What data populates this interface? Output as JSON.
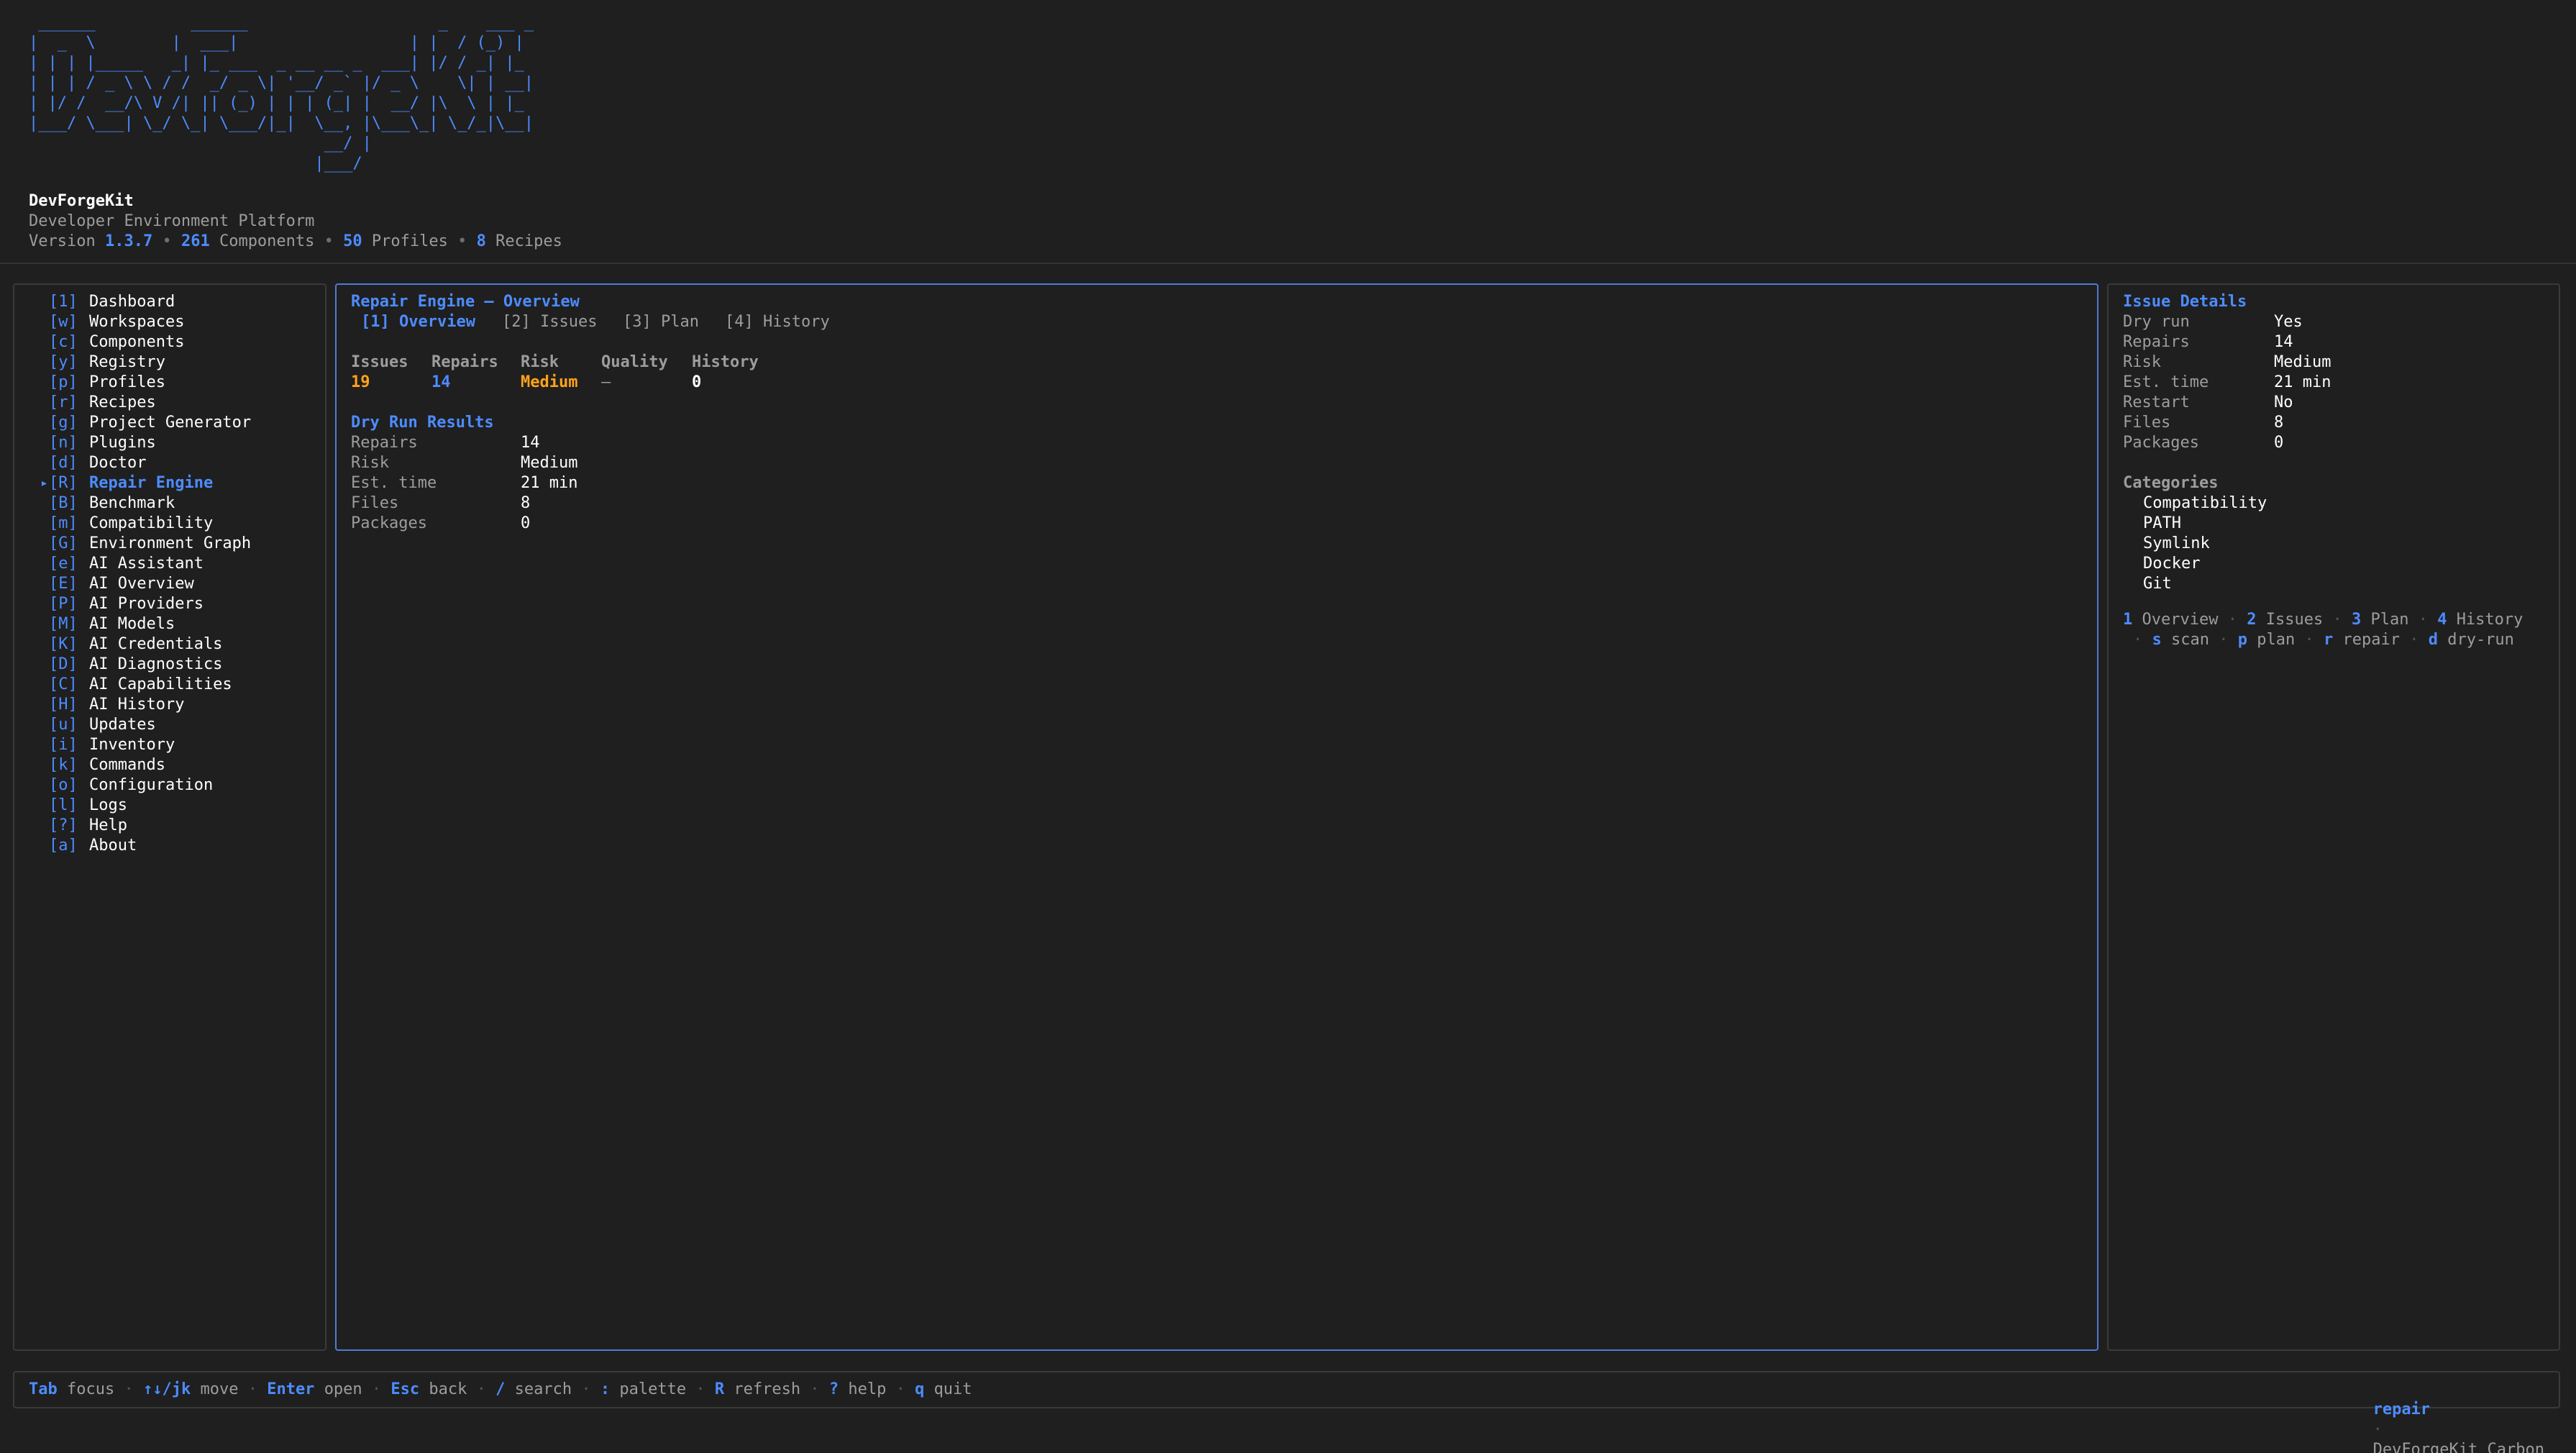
{
  "header": {
    "ascii_logo": " ______          ______                    _    ___ _\n|  _  \\        |  ___|                  | |  / (_) |\n| | | |_____   _| |_ ___  _ __ __ _  ___| |/ / _| |_\n| | | / _ \\ \\ / /  _/ _ \\| '__/ _` |/ _ \\    \\| | __|\n| |/ /  __/\\ V /| || (_) | | | (_| |  __/ |\\  \\ | |_\n|___/ \\___| \\_/ \\_| \\___/|_|  \\__, |\\___\\_| \\_/_|\\__|\n                               __/ |\n                              |___/",
    "brand_name": "DevForgeKit",
    "brand_sub": "Developer Environment Platform",
    "stats": {
      "version_label": "Version",
      "version": "1.3.7",
      "components_count": "261",
      "components_label": "Components",
      "profiles_count": "50",
      "profiles_label": "Profiles",
      "recipes_count": "8",
      "recipes_label": "Recipes",
      "sep": "•"
    }
  },
  "sidebar": {
    "items": [
      {
        "key": "[1]",
        "label": "Dashboard"
      },
      {
        "key": "[w]",
        "label": "Workspaces"
      },
      {
        "key": "[c]",
        "label": "Components"
      },
      {
        "key": "[y]",
        "label": "Registry"
      },
      {
        "key": "[p]",
        "label": "Profiles"
      },
      {
        "key": "[r]",
        "label": "Recipes"
      },
      {
        "key": "[g]",
        "label": "Project Generator"
      },
      {
        "key": "[n]",
        "label": "Plugins"
      },
      {
        "key": "[d]",
        "label": "Doctor"
      },
      {
        "key": "[R]",
        "label": "Repair Engine",
        "active": true
      },
      {
        "key": "[B]",
        "label": "Benchmark"
      },
      {
        "key": "[m]",
        "label": "Compatibility"
      },
      {
        "key": "[G]",
        "label": "Environment Graph"
      },
      {
        "key": "[e]",
        "label": "AI Assistant"
      },
      {
        "key": "[E]",
        "label": "AI Overview"
      },
      {
        "key": "[P]",
        "label": "AI Providers"
      },
      {
        "key": "[M]",
        "label": "AI Models"
      },
      {
        "key": "[K]",
        "label": "AI Credentials"
      },
      {
        "key": "[D]",
        "label": "AI Diagnostics"
      },
      {
        "key": "[C]",
        "label": "AI Capabilities"
      },
      {
        "key": "[H]",
        "label": "AI History"
      },
      {
        "key": "[u]",
        "label": "Updates"
      },
      {
        "key": "[i]",
        "label": "Inventory"
      },
      {
        "key": "[k]",
        "label": "Commands"
      },
      {
        "key": "[o]",
        "label": "Configuration"
      },
      {
        "key": "[l]",
        "label": "Logs"
      },
      {
        "key": "[?]",
        "label": "Help"
      },
      {
        "key": "[a]",
        "label": "About"
      }
    ],
    "active_marker": "▸"
  },
  "main": {
    "title": "Repair Engine — Overview",
    "tabs": [
      {
        "label": "[1] Overview",
        "active": true
      },
      {
        "label": "[2] Issues"
      },
      {
        "label": "[3] Plan"
      },
      {
        "label": "[4] History"
      }
    ],
    "summary": {
      "headers": [
        "Issues",
        "Repairs",
        "Risk",
        "Quality",
        "History"
      ],
      "values": [
        "19",
        "14",
        "Medium",
        "—",
        "0"
      ]
    },
    "dry_run": {
      "title": "Dry Run Results",
      "rows": [
        {
          "label": "Repairs",
          "value": "14"
        },
        {
          "label": "Risk",
          "value": "Medium"
        },
        {
          "label": "Est. time",
          "value": "21 min"
        },
        {
          "label": "Files",
          "value": "8"
        },
        {
          "label": "Packages",
          "value": "0"
        }
      ]
    }
  },
  "details": {
    "title": "Issue Details",
    "rows": [
      {
        "label": "Dry run",
        "value": "Yes"
      },
      {
        "label": "Repairs",
        "value": "14"
      },
      {
        "label": "Risk",
        "value": "Medium"
      },
      {
        "label": "Est. time",
        "value": "21 min"
      },
      {
        "label": "Restart",
        "value": "No"
      },
      {
        "label": "Files",
        "value": "8"
      },
      {
        "label": "Packages",
        "value": "0"
      }
    ],
    "categories_title": "Categories",
    "categories": [
      "Compatibility",
      "PATH",
      "Symlink",
      "Docker",
      "Git"
    ],
    "hints_line1": [
      {
        "key": "1",
        "label": "Overview"
      },
      {
        "key": "2",
        "label": "Issues"
      },
      {
        "key": "3",
        "label": "Plan"
      },
      {
        "key": "4",
        "label": "History"
      }
    ],
    "hints_line2": [
      {
        "key": "s",
        "label": "scan"
      },
      {
        "key": "p",
        "label": "plan"
      },
      {
        "key": "r",
        "label": "repair"
      },
      {
        "key": "d",
        "label": "dry-run"
      }
    ],
    "hint_sep": "·"
  },
  "status_bar": {
    "hints": [
      {
        "key": "Tab",
        "label": "focus"
      },
      {
        "key": "↑↓/jk",
        "label": "move"
      },
      {
        "key": "Enter",
        "label": "open"
      },
      {
        "key": "Esc",
        "label": "back"
      },
      {
        "key": "/",
        "label": "search"
      },
      {
        "key": ":",
        "label": "palette"
      },
      {
        "key": "R",
        "label": "refresh"
      },
      {
        "key": "?",
        "label": "help"
      },
      {
        "key": "q",
        "label": "quit"
      }
    ],
    "sep": "·",
    "mode": "repair",
    "theme": "DevForgeKit Carbon"
  },
  "colors": {
    "background": "#1f1f1f",
    "accent": "#4d8cff",
    "warning": "#ffa31a",
    "muted": "#9d9d9d"
  }
}
